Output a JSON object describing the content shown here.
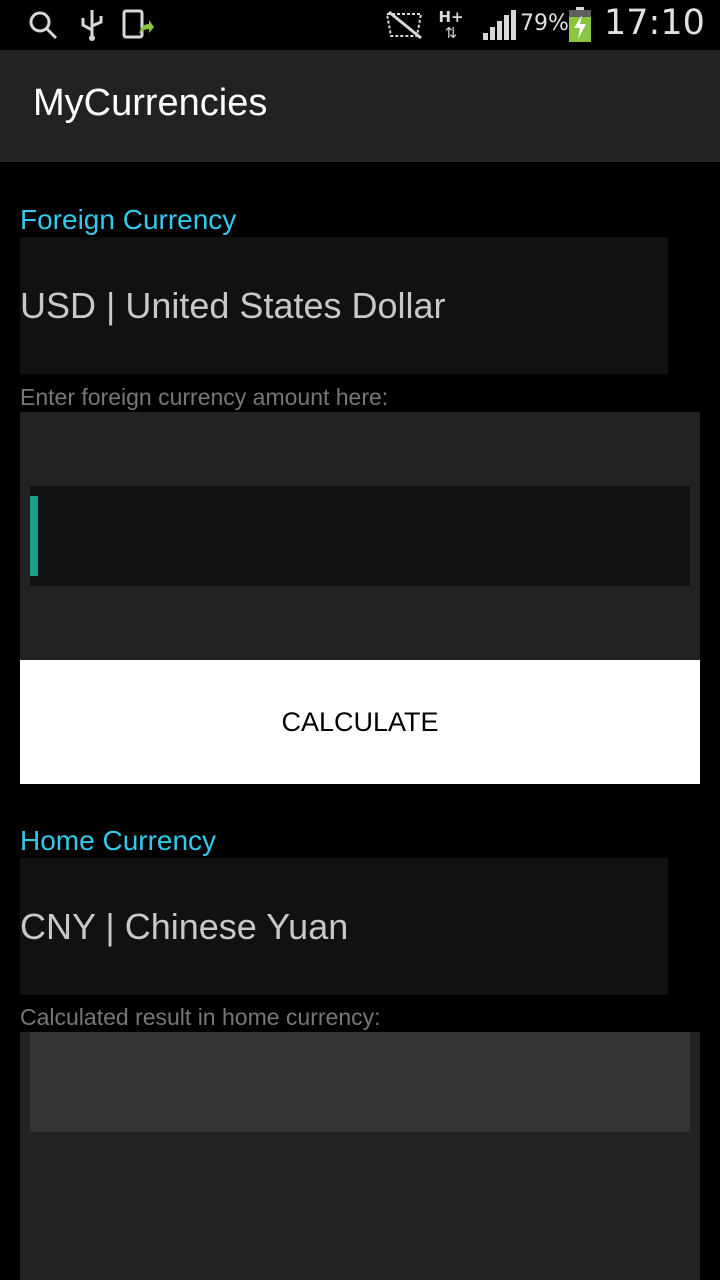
{
  "status_bar": {
    "battery_percent": "79%",
    "time": "17:10",
    "network_type": "H+",
    "icons": [
      "search-icon",
      "usb-icon",
      "screen-share-icon",
      "no-signal-icon",
      "network-data-icon",
      "signal-icon",
      "battery-charging-icon"
    ]
  },
  "app": {
    "title": "MyCurrencies"
  },
  "foreign": {
    "section_label": "Foreign Currency",
    "selected_currency": "USD | United States Dollar",
    "amount_hint": "Enter foreign currency amount here:",
    "amount_value": ""
  },
  "calculate_button": {
    "label": "CALCULATE"
  },
  "home": {
    "section_label": "Home Currency",
    "selected_currency": "CNY | Chinese Yuan",
    "result_hint": "Calculated result in home currency:",
    "result_value": ""
  },
  "colors": {
    "accent": "#33c9ee",
    "cursor": "#16a08a",
    "background": "#000000",
    "action_bar": "#222222"
  }
}
